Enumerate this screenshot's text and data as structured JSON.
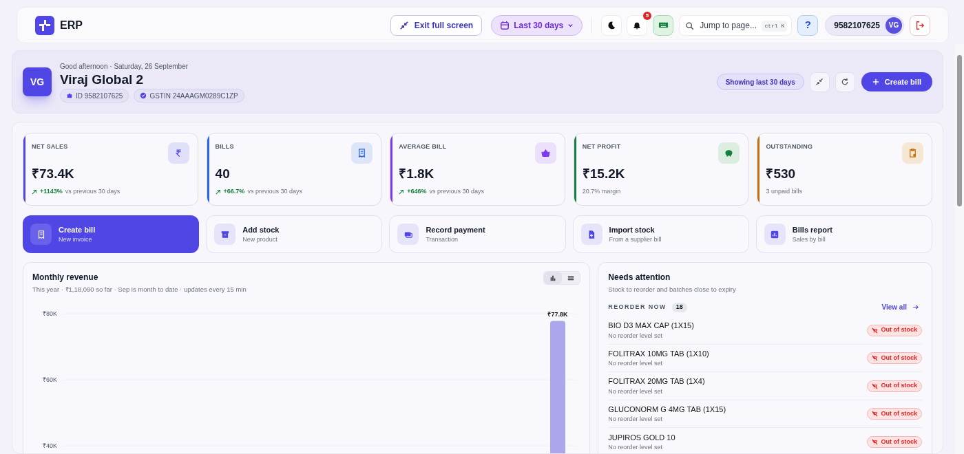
{
  "header": {
    "logo": "ERP",
    "exit_fullscreen": "Exit full screen",
    "date_range": "Last 30 days",
    "notifications": "5",
    "search": {
      "placeholder": "Jump to page...",
      "shortcut": "ctrl K"
    },
    "help": "?",
    "account": "9582107625",
    "avatar": "VG"
  },
  "hero": {
    "avatar": "VG",
    "greeting": "Good afternoon · Saturday, 26 September",
    "name": "Viraj Global 2",
    "chips": [
      {
        "kind": "id",
        "label": "ID 9582107625"
      },
      {
        "kind": "gstin",
        "label": "GSTIN 24AAAGM0289C1ZP"
      }
    ],
    "range_badge": "Showing last 30 days",
    "create": "Create bill"
  },
  "kpis": [
    {
      "label": "NET SALES",
      "value": "₹73.4K",
      "kind": "rupee",
      "color": "#4f46e5",
      "delta": "+1143%",
      "note": "vs previous 30 days"
    },
    {
      "label": "BILLS",
      "value": "40",
      "kind": "receipt",
      "color": "#2563eb",
      "delta": "+66.7%",
      "note": "vs previous 30 days"
    },
    {
      "label": "AVERAGE BILL",
      "value": "₹1.8K",
      "kind": "basket",
      "color": "#7c3aed",
      "delta": "+646%",
      "note": "vs previous 30 days"
    },
    {
      "label": "NET PROFIT",
      "value": "₹15.2K",
      "kind": "piggy",
      "color": "#15803d",
      "note": "20.7% margin"
    },
    {
      "label": "OUTSTANDING",
      "value": "₹530",
      "kind": "clipboard",
      "color": "#c2710c",
      "note": "3 unpaid bills"
    }
  ],
  "actions": [
    {
      "title": "Create bill",
      "subtitle": "New invoice",
      "kind": "receipt",
      "selected": true
    },
    {
      "title": "Add stock",
      "subtitle": "New product",
      "kind": "box",
      "selected": false
    },
    {
      "title": "Record payment",
      "subtitle": "Transaction",
      "kind": "cash",
      "selected": false
    },
    {
      "title": "Import stock",
      "subtitle": "From a supplier bill",
      "kind": "file",
      "selected": false
    },
    {
      "title": "Bills report",
      "subtitle": "Sales by bill",
      "kind": "chart",
      "selected": false
    }
  ],
  "revenue": {
    "title": "Monthly revenue",
    "subtitle": "This year · ₹1,18,090 so far · Sep is month to date · updates every 15 min",
    "views": [
      {
        "kind": "chart",
        "selected": true
      },
      {
        "kind": "list",
        "selected": false
      }
    ],
    "chart_data": {
      "type": "bar",
      "values": [
        77800
      ],
      "value_labels": [
        "₹77.8K"
      ],
      "ylim": [
        0,
        80000
      ],
      "yticks": [
        {
          "value": 80000,
          "label": "₹80K"
        },
        {
          "value": 60000,
          "label": "₹60K"
        },
        {
          "value": 40000,
          "label": "₹40K"
        }
      ]
    }
  },
  "attention": {
    "title": "Needs attention",
    "subtitle": "Stock to reorder and batches close to expiry",
    "section": "REORDER NOW",
    "count": "18",
    "view_all": "View all",
    "items": [
      {
        "name": "BIO D3 MAX CAP (1X15)",
        "note": "No reorder level set",
        "status": "Out of stock"
      },
      {
        "name": "FOLITRAX 10MG TAB (1X10)",
        "note": "No reorder level set",
        "status": "Out of stock"
      },
      {
        "name": "FOLITRAX 20MG TAB (1X4)",
        "note": "No reorder level set",
        "status": "Out of stock"
      },
      {
        "name": "GLUCONORM G 4MG TAB (1X15)",
        "note": "No reorder level set",
        "status": "Out of stock"
      },
      {
        "name": "JUPIROS GOLD 10",
        "note": "No reorder level set",
        "status": "Out of stock"
      }
    ]
  }
}
